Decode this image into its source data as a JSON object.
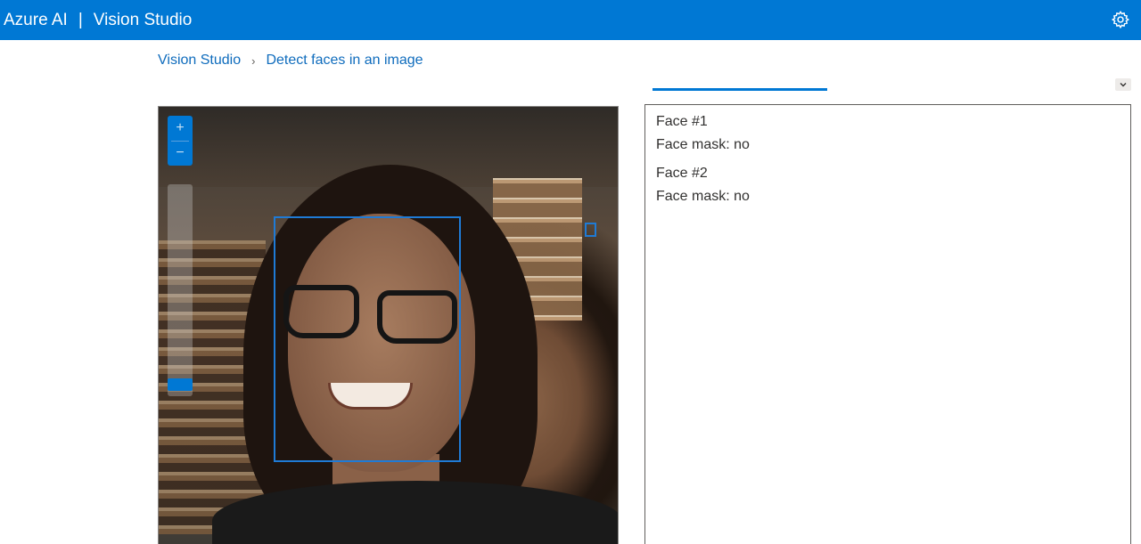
{
  "header": {
    "product": "Azure AI",
    "separator": "|",
    "app": "Vision Studio",
    "settings_icon": "gear-icon",
    "accent_color": "#0078d4"
  },
  "breadcrumb": {
    "root": "Vision Studio",
    "chevron": "›",
    "current": "Detect faces in an image"
  },
  "collapse": {
    "icon": "chevron-down-icon",
    "glyph": "⌄"
  },
  "viewer": {
    "zoom_in": "+",
    "zoom_out": "−",
    "box_color": "#1f7bd6"
  },
  "results": {
    "faces": [
      {
        "title": "Face #1",
        "mask": "Face mask: no"
      },
      {
        "title": "Face #2",
        "mask": "Face mask: no"
      }
    ]
  }
}
